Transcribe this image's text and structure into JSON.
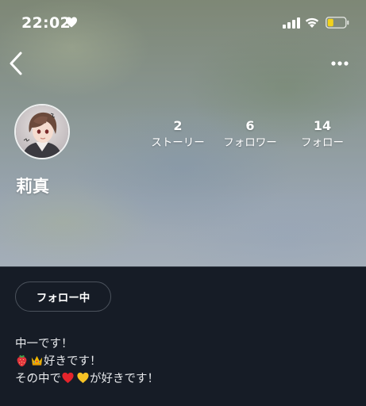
{
  "status_bar": {
    "time": "22:02",
    "icons": [
      "heart-icon",
      "signal-icon",
      "wifi-icon",
      "battery-icon"
    ],
    "battery_color": "#f2d21b"
  },
  "nav": {
    "back_icon": "chevron-left-icon",
    "more_icon": "more-horizontal-icon"
  },
  "profile": {
    "name": "莉真",
    "avatar": "avatar-illustration"
  },
  "stats": {
    "stories": {
      "count": "2",
      "label": "ストーリー"
    },
    "followers": {
      "count": "6",
      "label": "フォロワー"
    },
    "following": {
      "count": "14",
      "label": "フォロー"
    }
  },
  "follow_button": {
    "label": "フォロー中"
  },
  "bio": {
    "line1": "中一です！",
    "line2_emojis": [
      "strawberry-emoji",
      "crown-emoji"
    ],
    "line2_text": "好きです！",
    "line3_prefix": "その中で",
    "line3_emojis": [
      "red-heart-emoji",
      "yellow-heart-emoji"
    ],
    "line3_suffix": "が好きです！"
  },
  "colors": {
    "panel_background": "#161c26",
    "text": "#ffffff",
    "red_heart": "#e5242b",
    "yellow_heart": "#f7c325"
  }
}
